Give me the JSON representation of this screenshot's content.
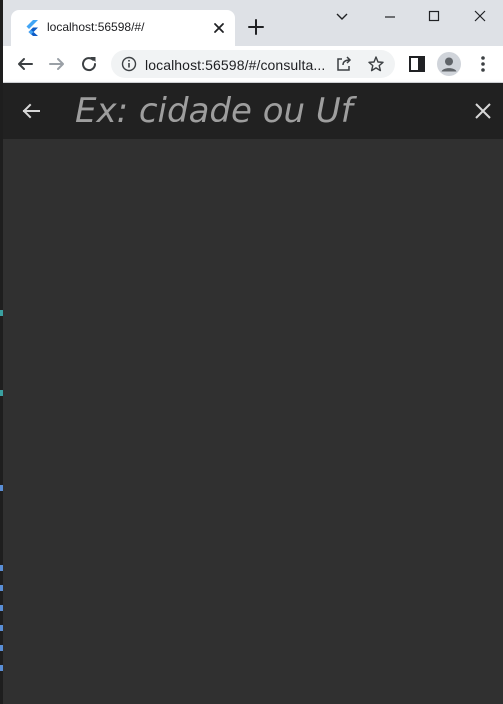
{
  "browser": {
    "tab": {
      "title": "localhost:56598/#/"
    },
    "address": {
      "url": "localhost:56598/#/consulta..."
    }
  },
  "app": {
    "search": {
      "placeholder": "Ex: cidade ou Uf",
      "value": ""
    }
  },
  "colors": {
    "appbar": "#212121",
    "content": "#303030",
    "placeholder": "#9e9e9e",
    "tabstrip": "#dee1e6",
    "flutter_blue": "#42a5f5"
  },
  "icons": [
    "flutter-icon",
    "close-icon",
    "plus-icon",
    "chevron-down-icon",
    "minimize-icon",
    "maximize-icon",
    "close-window-icon",
    "back-icon",
    "forward-icon",
    "reload-icon",
    "info-icon",
    "share-icon",
    "star-icon",
    "sidebar-icon",
    "profile-icon",
    "more-icon",
    "arrow-back-icon",
    "clear-icon"
  ]
}
